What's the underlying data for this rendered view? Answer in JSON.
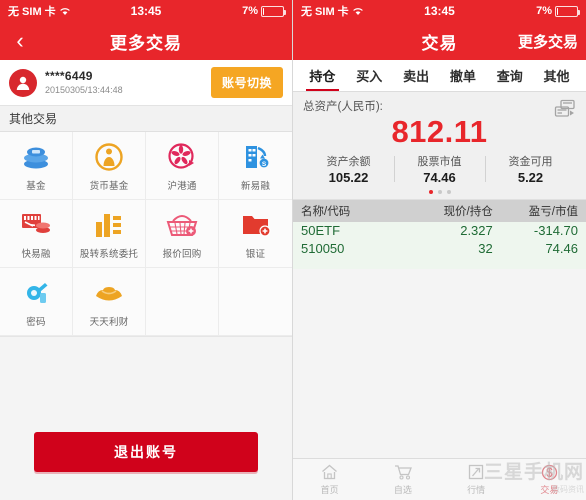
{
  "left": {
    "status_bar": {
      "carrier": "无 SIM 卡",
      "wifi_icon": "wifi-icon",
      "time": "13:45",
      "battery_pct": "7%",
      "battery_icon": "battery-icon"
    },
    "navbar": {
      "back_icon": "chevron-left-icon",
      "title": "更多交易"
    },
    "account": {
      "avatar_icon": "user-avatar-icon",
      "masked_id": "****6449",
      "login_time": "20150305/13:44:48",
      "switch_label": "账号切换"
    },
    "section_title": "其他交易",
    "grid": [
      {
        "label": "基金",
        "icon": "coins-stack-icon",
        "color": "#3d8fdd"
      },
      {
        "label": "货币基金",
        "icon": "person-circle-icon",
        "color": "#eda423"
      },
      {
        "label": "沪港通",
        "icon": "bauhinia-arrow-icon",
        "color": "#e0295c"
      },
      {
        "label": "新易融",
        "icon": "building-dollar-icon",
        "color": "#2e92e0"
      },
      {
        "label": "快易融",
        "icon": "banknote-coins-icon",
        "color": "#e0403c"
      },
      {
        "label": "股转系统委托",
        "icon": "bar-chart-icon",
        "color": "#eda423"
      },
      {
        "label": "报价回购",
        "icon": "basket-icon",
        "color": "#ec5a78"
      },
      {
        "label": "银证",
        "icon": "folder-plus-icon",
        "color": "#e23b2e"
      },
      {
        "label": "密码",
        "icon": "lock-key-icon",
        "color": "#33b5e8"
      },
      {
        "label": "天天利财",
        "icon": "gold-ingot-icon",
        "color": "#eda423"
      }
    ],
    "logout_label": "退出账号"
  },
  "right": {
    "status_bar": {
      "carrier": "无 SIM 卡",
      "wifi_icon": "wifi-icon",
      "time": "13:45",
      "battery_pct": "7%",
      "battery_icon": "battery-icon"
    },
    "navbar": {
      "title": "交易",
      "right_label": "更多交易"
    },
    "tabs": [
      {
        "label": "持仓",
        "active": true
      },
      {
        "label": "买入",
        "active": false
      },
      {
        "label": "卖出",
        "active": false
      },
      {
        "label": "撤单",
        "active": false
      },
      {
        "label": "查询",
        "active": false
      },
      {
        "label": "其他",
        "active": false
      }
    ],
    "asset": {
      "label": "总资产(人民币):",
      "card_icon": "card-switch-icon",
      "total": "812.11",
      "total_color": "#e8262b",
      "columns": [
        {
          "key": "资产余额",
          "value": "105.22"
        },
        {
          "key": "股票市值",
          "value": "74.46"
        },
        {
          "key": "资金可用",
          "value": "5.22"
        }
      ],
      "page_dots": 3,
      "active_dot": 0
    },
    "table": {
      "headers": [
        "名称/代码",
        "现价/持仓",
        "盈亏/市值"
      ],
      "rows": [
        {
          "c1": "50ETF",
          "c2": "2.327",
          "c3": "-314.70"
        },
        {
          "c1": "510050",
          "c2": "32",
          "c3": "74.46"
        }
      ],
      "text_color": "#1f6b35"
    },
    "bottom_nav": [
      {
        "label": "首页",
        "icon": "home-icon",
        "active": false
      },
      {
        "label": "自选",
        "icon": "cart-icon",
        "active": false
      },
      {
        "label": "行情",
        "icon": "trend-arrow-icon",
        "active": false
      },
      {
        "label": "交易",
        "icon": "dollar-circle-icon",
        "active": true
      }
    ],
    "watermark": {
      "line1": "三星手机网",
      "line2": "数码资讯"
    }
  }
}
